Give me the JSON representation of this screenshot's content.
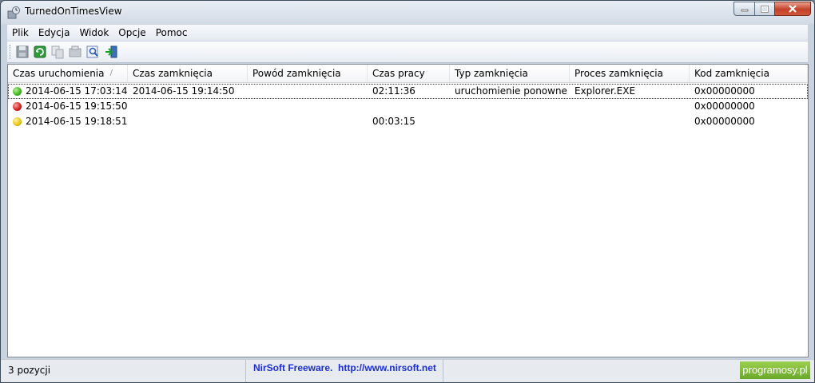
{
  "window": {
    "title": "TurnedOnTimesView"
  },
  "menu": [
    "Plik",
    "Edycja",
    "Widok",
    "Opcje",
    "Pomoc"
  ],
  "toolbar": {
    "icons": [
      "save-icon",
      "refresh-icon",
      "copy-icon",
      "properties-icon",
      "find-icon",
      "exit-icon"
    ]
  },
  "table": {
    "columns": [
      "Czas uruchomienia",
      "Czas zamknięcia",
      "Powód zamknięcia",
      "Czas pracy",
      "Typ zamknięcia",
      "Proces zamknięcia",
      "Kod zamknięcia"
    ],
    "sort_indicator": "/",
    "rows": [
      {
        "status": "green",
        "status_color": "#3cb21a",
        "cells": [
          "2014-06-15 17:03:14",
          "2014-06-15 19:14:50",
          "",
          "02:11:36",
          "uruchomienie ponowne",
          "Explorer.EXE",
          "0x00000000"
        ]
      },
      {
        "status": "red",
        "status_color": "#d21b1b",
        "cells": [
          "2014-06-15 19:15:50",
          "",
          "",
          "",
          "",
          "",
          "0x00000000"
        ]
      },
      {
        "status": "yellow",
        "status_color": "#e5c20c",
        "cells": [
          "2014-06-15 19:18:51",
          "",
          "",
          "00:03:15",
          "",
          "",
          "0x00000000"
        ]
      }
    ]
  },
  "status": {
    "count": "3 pozycji",
    "link": "NirSoft Freeware.  http://www.nirsoft.net"
  },
  "watermark": "programosy.pl"
}
